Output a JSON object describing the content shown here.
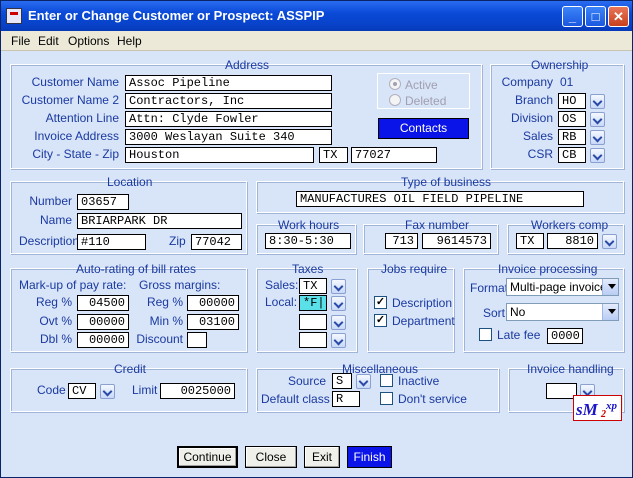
{
  "window": {
    "title": "Enter or Change Customer or Prospect:  ASSPIP"
  },
  "menu": [
    "File",
    "Edit",
    "Options",
    "Help"
  ],
  "address": {
    "title": "Address",
    "labels": {
      "name": "Customer Name",
      "name2": "Customer Name 2",
      "attn": "Attention Line",
      "invaddr": "Invoice Address",
      "csz": "City - State - Zip"
    },
    "name": "Assoc Pipeline",
    "name2": "Contractors, Inc",
    "attn": "Attn: Clyde Fowler",
    "invaddr": "3000 Weslayan Suite 340",
    "city": "Houston",
    "state": "TX",
    "zip": "77027",
    "active_label": "Active",
    "deleted_label": "Deleted",
    "contacts_label": "Contacts"
  },
  "ownership": {
    "title": "Ownership",
    "labels": {
      "company": "Company",
      "branch": "Branch",
      "division": "Division",
      "sales": "Sales",
      "csr": "CSR"
    },
    "company": "01",
    "branch": "HO",
    "division": "OS",
    "sales": "RB",
    "csr": "CB"
  },
  "location": {
    "title": "Location",
    "labels": {
      "number": "Number",
      "name": "Name",
      "desc": "Description",
      "zip": "Zip"
    },
    "number": "03657",
    "name": "BRIARPARK DR",
    "desc": "#110",
    "zip": "77042"
  },
  "business": {
    "title": "Type of business",
    "value": "MANUFACTURES OIL FIELD PIPELINE"
  },
  "work_hours": {
    "title": "Work hours",
    "value": "8:30-5:30"
  },
  "fax": {
    "title": "Fax number",
    "area": "713",
    "number": "9614573"
  },
  "workers_comp": {
    "title": "Workers comp",
    "state": "TX",
    "code": "8810"
  },
  "autorating": {
    "title": "Auto-rating of bill rates",
    "markup_label": "Mark-up of pay rate:",
    "gross_label": "Gross margins:",
    "reg_label": "Reg %",
    "ovt_label": "Ovt %",
    "dbl_label": "Dbl %",
    "greg_label": "Reg %",
    "min_label": "Min %",
    "discount_label": "Discount",
    "reg": "04500",
    "ovt": "00000",
    "dbl": "00000",
    "greg": "00000",
    "min": "03100",
    "discount": ""
  },
  "taxes": {
    "title": "Taxes",
    "sales_label": "Sales:",
    "local_label": "Local:",
    "sales": "TX",
    "local": "*F|",
    "local2": "",
    "local3": ""
  },
  "jobs": {
    "title": "Jobs require",
    "desc_label": "Description",
    "dept_label": "Department",
    "desc_checked": "✓",
    "dept_checked": "✓"
  },
  "invoice_proc": {
    "title": "Invoice processing",
    "format_label": "Format",
    "format": "Multi-page invoice",
    "sort_label": "Sort",
    "sort": "No",
    "late_label": "Late fee",
    "late": "0000"
  },
  "credit": {
    "title": "Credit",
    "code_label": "Code",
    "code": "CV",
    "limit_label": "Limit",
    "limit": "0025000"
  },
  "misc": {
    "title": "Miscellaneous",
    "source_label": "Source",
    "source": "S",
    "defclass_label": "Default class",
    "defclass": "R",
    "inactive_label": "Inactive",
    "dontservice_label": "Don't service"
  },
  "inv_handling": {
    "title": "Invoice handling",
    "value": ""
  },
  "buttons": {
    "continue": "Continue",
    "close": "Close",
    "exit": "Exit",
    "finish": "Finish"
  },
  "logo": {
    "text": "sM2xp"
  }
}
